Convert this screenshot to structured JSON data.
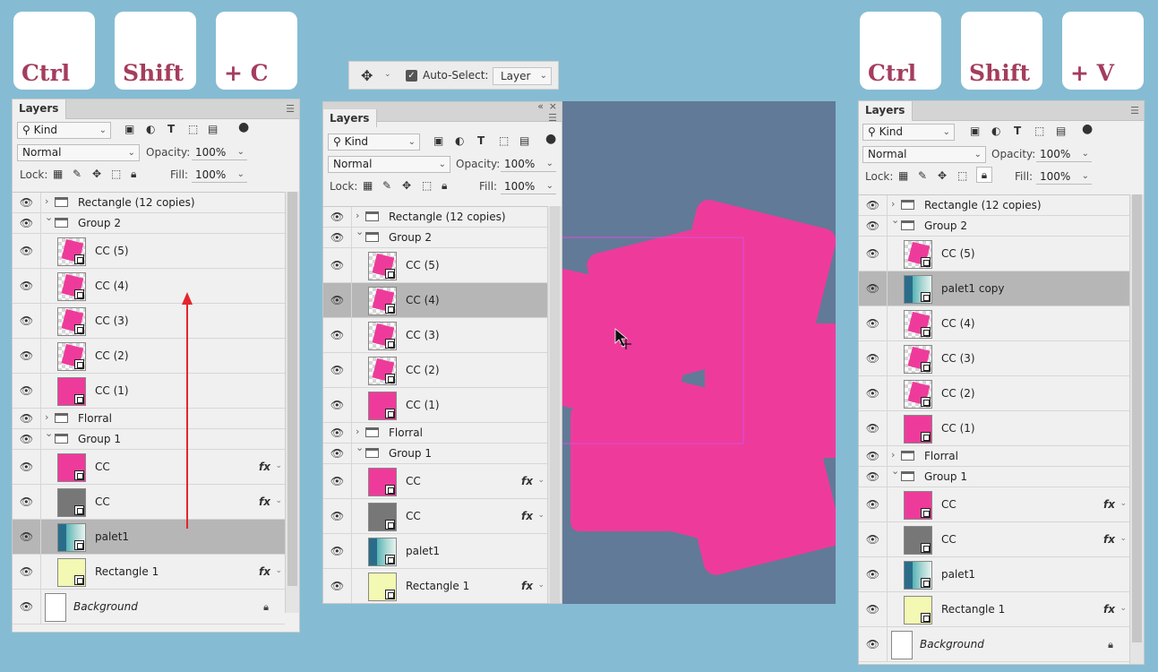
{
  "keys_left": [
    "Ctrl",
    "Shift",
    "+ C"
  ],
  "keys_right": [
    "Ctrl",
    "Shift",
    "+ V"
  ],
  "options_bar": {
    "auto_select_label": "Auto-Select:",
    "auto_select_checked": true,
    "target": "Layer"
  },
  "common": {
    "tab": "Layers",
    "filter": "Kind",
    "blend": "Normal",
    "opacity_label": "Opacity:",
    "opacity": "100%",
    "lock_label": "Lock:",
    "fill_label": "Fill:",
    "fill": "100%",
    "fx": "fx"
  },
  "panel_left": {
    "layers": [
      {
        "name": "Rectangle (12 copies)",
        "kind": "group",
        "expanded": false
      },
      {
        "name": "Group 2",
        "kind": "group",
        "expanded": true
      },
      {
        "name": "CC (5)",
        "kind": "rot"
      },
      {
        "name": "CC (4)",
        "kind": "rot"
      },
      {
        "name": "CC (3)",
        "kind": "rot"
      },
      {
        "name": "CC (2)",
        "kind": "rot"
      },
      {
        "name": "CC (1)",
        "kind": "pink"
      },
      {
        "name": "Florral",
        "kind": "group",
        "expanded": false
      },
      {
        "name": "Group 1",
        "kind": "group",
        "expanded": true
      },
      {
        "name": "CC",
        "kind": "pink",
        "fx": true
      },
      {
        "name": "CC",
        "kind": "grey",
        "fx": true
      },
      {
        "name": "palet1",
        "kind": "pal",
        "selected": true
      },
      {
        "name": "Rectangle 1",
        "kind": "yellow",
        "fx": true
      },
      {
        "name": "Background",
        "kind": "bg",
        "locked": true
      }
    ]
  },
  "panel_mid": {
    "layers": [
      {
        "name": "Rectangle (12 copies)",
        "kind": "group",
        "expanded": false
      },
      {
        "name": "Group 2",
        "kind": "group",
        "expanded": true
      },
      {
        "name": "CC (5)",
        "kind": "rot"
      },
      {
        "name": "CC (4)",
        "kind": "rot",
        "selected": true
      },
      {
        "name": "CC (3)",
        "kind": "rot"
      },
      {
        "name": "CC (2)",
        "kind": "rot"
      },
      {
        "name": "CC (1)",
        "kind": "pink"
      },
      {
        "name": "Florral",
        "kind": "group",
        "expanded": false
      },
      {
        "name": "Group 1",
        "kind": "group",
        "expanded": true
      },
      {
        "name": "CC",
        "kind": "pink",
        "fx": true
      },
      {
        "name": "CC",
        "kind": "grey",
        "fx": true
      },
      {
        "name": "palet1",
        "kind": "pal"
      },
      {
        "name": "Rectangle 1",
        "kind": "yellow",
        "fx": true
      }
    ]
  },
  "panel_right": {
    "layers": [
      {
        "name": "Rectangle (12 copies)",
        "kind": "group",
        "expanded": false
      },
      {
        "name": "Group 2",
        "kind": "group",
        "expanded": true
      },
      {
        "name": "CC (5)",
        "kind": "rot"
      },
      {
        "name": "palet1 copy",
        "kind": "pal",
        "selected": true
      },
      {
        "name": "CC (4)",
        "kind": "rot"
      },
      {
        "name": "CC (3)",
        "kind": "rot"
      },
      {
        "name": "CC (2)",
        "kind": "rot"
      },
      {
        "name": "CC (1)",
        "kind": "pink"
      },
      {
        "name": "Florral",
        "kind": "group",
        "expanded": false
      },
      {
        "name": "Group 1",
        "kind": "group",
        "expanded": true
      },
      {
        "name": "CC",
        "kind": "pink",
        "fx": true
      },
      {
        "name": "CC",
        "kind": "grey",
        "fx": true
      },
      {
        "name": "palet1",
        "kind": "pal"
      },
      {
        "name": "Rectangle 1",
        "kind": "yellow",
        "fx": true
      },
      {
        "name": "Background",
        "kind": "bg",
        "locked": true
      }
    ]
  },
  "colors": {
    "background": "#85bcd3",
    "key_text": "#a43d5e",
    "pink": "#ee3b9b",
    "canvas": "#617a97",
    "arrow": "#e5252e"
  }
}
